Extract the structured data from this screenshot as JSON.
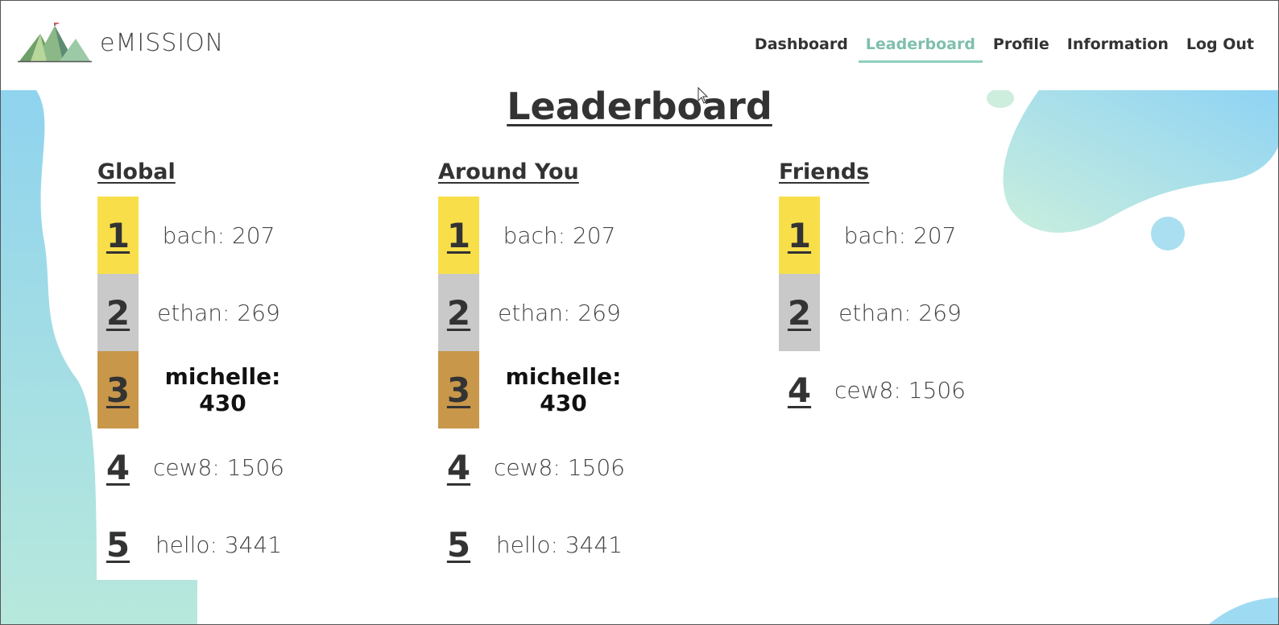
{
  "brand": {
    "name": "eMISSION"
  },
  "nav": {
    "items": [
      {
        "label": "Dashboard",
        "active": false
      },
      {
        "label": "Leaderboard",
        "active": true
      },
      {
        "label": "Profile",
        "active": false
      },
      {
        "label": "Information",
        "active": false
      },
      {
        "label": "Log Out",
        "active": false
      }
    ]
  },
  "page": {
    "title": "Leaderboard"
  },
  "colors": {
    "gold": "#f8df4a",
    "silver": "#c9c9c9",
    "bronze": "#c8974a",
    "accent": "#7fbfad"
  },
  "boards": {
    "global": {
      "heading": "Global",
      "rows": [
        {
          "rank": "1",
          "text": "bach: 207"
        },
        {
          "rank": "2",
          "text": "ethan: 269"
        },
        {
          "rank": "3",
          "text": "michelle: 430"
        },
        {
          "rank": "4",
          "text": "cew8: 1506"
        },
        {
          "rank": "5",
          "text": "hello: 3441"
        }
      ]
    },
    "around": {
      "heading": "Around You",
      "rows": [
        {
          "rank": "1",
          "text": "bach: 207"
        },
        {
          "rank": "2",
          "text": "ethan: 269"
        },
        {
          "rank": "3",
          "text": "michelle: 430"
        },
        {
          "rank": "4",
          "text": "cew8: 1506"
        },
        {
          "rank": "5",
          "text": "hello: 3441"
        }
      ]
    },
    "friends": {
      "heading": "Friends",
      "rows": [
        {
          "rank": "1",
          "text": "bach: 207"
        },
        {
          "rank": "2",
          "text": "ethan: 269"
        },
        {
          "rank": "4",
          "text": "cew8: 1506"
        }
      ]
    }
  }
}
